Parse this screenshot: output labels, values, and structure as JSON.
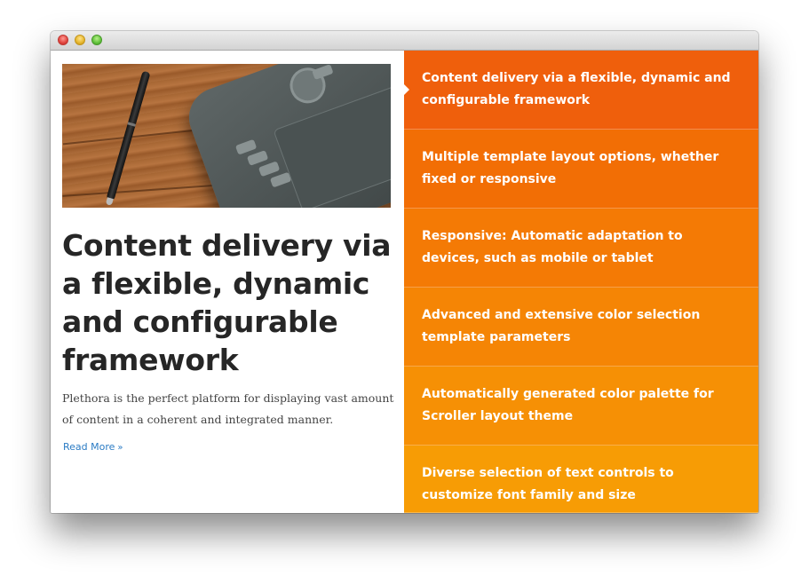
{
  "window": {
    "controls": [
      "close",
      "minimize",
      "zoom"
    ]
  },
  "article": {
    "image_icon": "tablet-and-pen-photo",
    "title": "Content delivery via a flexible, dynamic and configurable framework",
    "description": "Plethora is the perfect platform for displaying vast amount of content in a coherent and integrated manner.",
    "read_more": "Read More",
    "read_more_icon": "double-chevron-right-icon"
  },
  "features": {
    "items": [
      {
        "label": "Content delivery via a flexible, dynamic and configurable framework",
        "color": "#ef5f0c",
        "active": true
      },
      {
        "label": "Multiple template layout options, whether fixed or responsive",
        "color": "#f26e05"
      },
      {
        "label": "Responsive: Automatic adaptation to devices, such as mobile or tablet",
        "color": "#f47a05"
      },
      {
        "label": "Advanced and extensive color selection template parameters",
        "color": "#f58505"
      },
      {
        "label": "Automatically generated color palette for Scroller layout theme",
        "color": "#f69005"
      },
      {
        "label": "Diverse selection of text controls to customize font family and size",
        "color": "#f79c05"
      }
    ]
  },
  "colors": {
    "accent_link": "#2a7bc4",
    "heading": "#262626"
  }
}
